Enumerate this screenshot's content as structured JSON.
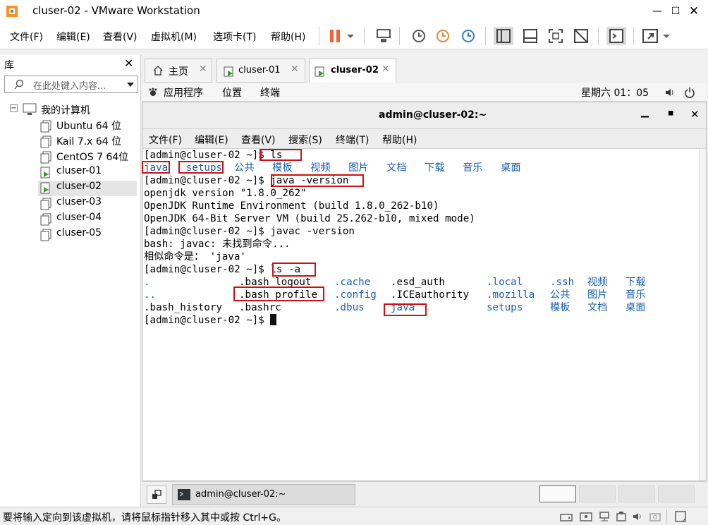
{
  "window": {
    "title": "cluser-02 - VMware Workstation"
  },
  "menubar": [
    "文件(F)",
    "编辑(E)",
    "查看(V)",
    "虚拟机(M)",
    "选项卡(T)",
    "帮助(H)"
  ],
  "library": {
    "title": "库",
    "search_placeholder": "在此处键入内容...",
    "root": "我的计算机",
    "vms": [
      "Ubuntu 64 位",
      "Kail 7.x 64 位",
      "CentOS 7 64位",
      "cluser-01",
      "cluser-02",
      "cluser-03",
      "cluser-04",
      "cluser-05"
    ]
  },
  "tabs": [
    {
      "label": "主页"
    },
    {
      "label": "cluser-01"
    },
    {
      "label": "cluser-02"
    }
  ],
  "gnome": {
    "apps": "应用程序",
    "places": "位置",
    "terminal": "终端",
    "clock": "星期六 01：05"
  },
  "terminal": {
    "title": "admin@cluser-02:~",
    "menu": [
      "文件(F)",
      "编辑(E)",
      "查看(V)",
      "搜索(S)",
      "终端(T)",
      "帮助(H)"
    ]
  },
  "taskbar": {
    "label": "admin@cluser-02:~"
  },
  "status": {
    "text": "要将输入定向到该虚拟机，请将鼠标指针移入其中或按 Ctrl+G。"
  },
  "prompt": "[admin@cluser-02 ~]$",
  "cmd": {
    "ls": "ls",
    "java_version": "java -version",
    "javac_version": "javac -version",
    "ls_a": "ls -a"
  },
  "ls_output": {
    "java": "java",
    "setups": "setups",
    "others": "公共   模板   视频   图片   文档   下载   音乐   桌面"
  },
  "java_output": [
    "openjdk version \"1.8.0_262\"",
    "OpenJDK Runtime Environment (build 1.8.0_262-b10)",
    "OpenJDK 64-Bit Server VM (build 25.262-b10, mixed mode)"
  ],
  "javac_output": [
    "bash: javac: 未找到命令...",
    "相似命令是： 'java'"
  ],
  "ls_a_rows": [
    {
      "c1": ".",
      "c2": ".bash_logout",
      "c3": ".cache",
      "c4": ".esd_auth",
      "c5": ".local",
      "c6": ".ssh",
      "c7": "视频",
      "c8": "下载"
    },
    {
      "c1": "..",
      "c2": ".bash_profile",
      "c3": ".config",
      "c4": ".ICEauthority",
      "c5": ".mozilla",
      "c6": "公共",
      "c7": "图片",
      "c8": "音乐"
    },
    {
      "c1": ".bash_history",
      "c2": ".bashrc",
      "c3": ".dbus",
      "c4": "java",
      "c5": "setups",
      "c6": "模板",
      "c7": "文档",
      "c8": "桌面"
    }
  ]
}
